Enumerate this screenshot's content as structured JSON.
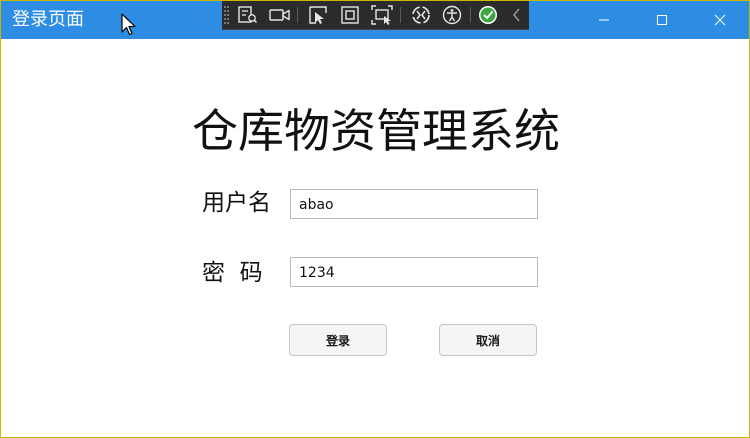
{
  "window": {
    "title": "登录页面",
    "controls": {
      "minimize_icon": "minimize-icon",
      "maximize_icon": "maximize-icon",
      "close_icon": "close-icon"
    },
    "titlebar_color": "#2d8de3"
  },
  "devtools": {
    "icons": [
      "live-visual-tree-icon",
      "video-camera-icon",
      "select-element-icon",
      "display-layout-adorners-icon",
      "track-focus-icon",
      "hot-reload-icon",
      "accessibility-icon",
      "binding-ok-icon",
      "collapse-chevron-icon"
    ]
  },
  "main": {
    "heading": "仓库物资管理系统",
    "username": {
      "label": "用户名",
      "value": "abao"
    },
    "password": {
      "label": "密  码",
      "value": "1234"
    },
    "buttons": {
      "login": "登录",
      "cancel": "取消"
    }
  }
}
